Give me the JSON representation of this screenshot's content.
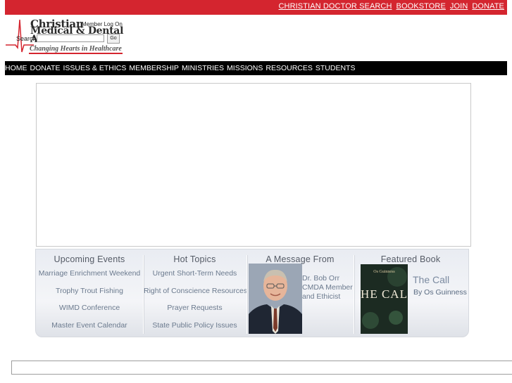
{
  "top_links": [
    "CHRISTIAN DOCTOR SEARCH",
    "BOOKSTORE",
    "JOIN",
    "DONATE"
  ],
  "logo": {
    "line1": "Christian",
    "line2": "Medical & Dental",
    "line3": "As",
    "tagline": "Changing Hearts in Healthcare"
  },
  "member": {
    "log_on_label": "Member Log On",
    "search_label": "Search",
    "search_value": "",
    "go_label": "Go"
  },
  "nav": [
    "HOME",
    "DONATE",
    "ISSUES & ETHICS",
    "MEMBERSHIP",
    "MINISTRIES",
    "MISSIONS",
    "RESOURCES",
    "STUDENTS"
  ],
  "panel": {
    "events": {
      "title": "Upcoming Events",
      "items": [
        "Marriage Enrichment Weekend",
        "Trophy Trout Fishing",
        "WIMD Conference",
        "Master Event Calendar"
      ]
    },
    "topics": {
      "title": "Hot Topics",
      "items": [
        "Urgent Short-Term Needs",
        "Right of Conscience Resources",
        "Prayer Requests",
        "State Public Policy Issues"
      ]
    },
    "message": {
      "title": "A Message From",
      "name": "Dr. Bob Orr",
      "line2": "CMDA Member",
      "line3": "and Ethicist"
    },
    "book": {
      "title": "Featured Book",
      "book_title": "The Call",
      "author": "By Os Guinness",
      "cover_author": "Os Guinness",
      "cover_title": "THE CALL"
    }
  },
  "colors": {
    "topbar": "#d4252f",
    "nav_bg": "#000000",
    "panel_text": "#6b7a8e"
  }
}
